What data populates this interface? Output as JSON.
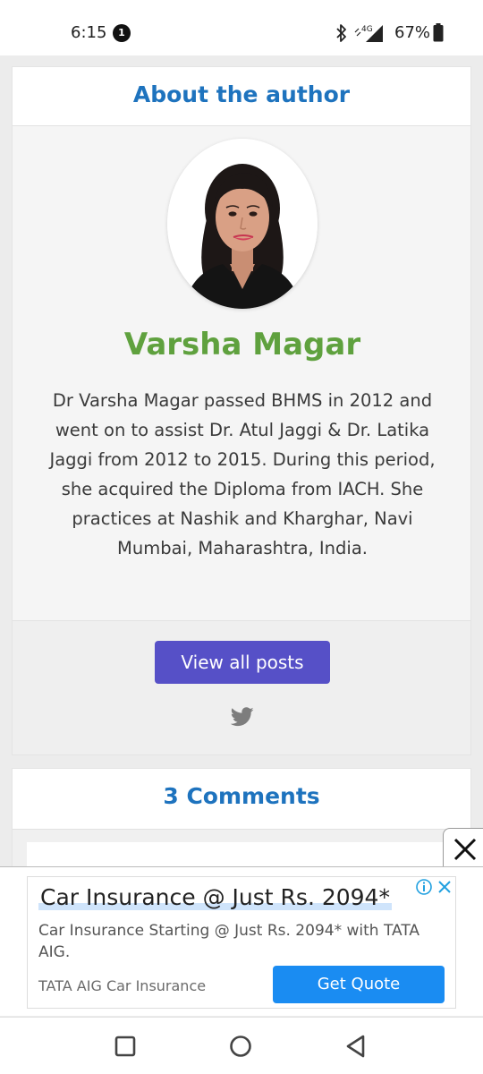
{
  "status_bar": {
    "time": "6:15",
    "notification_count": "1",
    "network": "4G",
    "battery": "67%"
  },
  "author_section": {
    "heading": "About the author",
    "name": "Varsha Magar",
    "bio": "Dr Varsha Magar passed BHMS in 2012 and went on to assist Dr. Atul Jaggi & Dr. Latika Jaggi from 2012 to 2015. During this period, she acquired the Diploma from IACH. She practices at Nashik and Kharghar, Navi Mumbai, Maharashtra, India.",
    "view_posts_label": "View all posts",
    "social_icon": "twitter-icon"
  },
  "comments_section": {
    "heading": "3 Comments"
  },
  "ad": {
    "title": "Car Insurance @ Just Rs. 2094*",
    "text": "Car Insurance Starting @ Just Rs. 2094* with TATA AIG.",
    "brand": "TATA AIG Car Insurance",
    "cta_label": "Get Quote"
  },
  "colors": {
    "heading_blue": "#1e73be",
    "name_green": "#5fa13e",
    "button_purple": "#5650c7",
    "ad_cta_blue": "#1a8cf2"
  }
}
